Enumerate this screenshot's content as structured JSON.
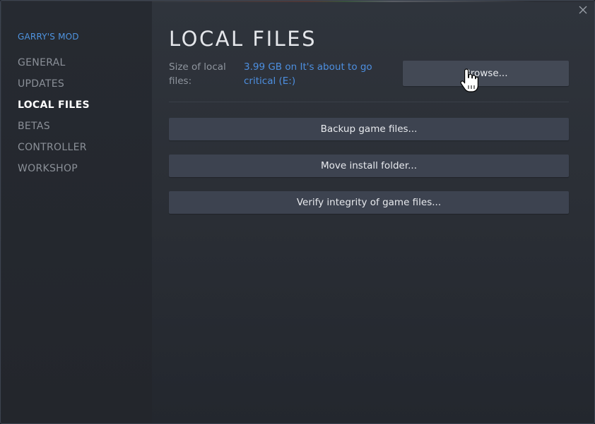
{
  "sidebar": {
    "game_title": "GARRY'S MOD",
    "items": [
      {
        "label": "GENERAL",
        "active": false
      },
      {
        "label": "UPDATES",
        "active": false
      },
      {
        "label": "LOCAL FILES",
        "active": true
      },
      {
        "label": "BETAS",
        "active": false
      },
      {
        "label": "CONTROLLER",
        "active": false
      },
      {
        "label": "WORKSHOP",
        "active": false
      }
    ]
  },
  "main": {
    "title": "LOCAL FILES",
    "size_label": "Size of local files:",
    "size_value": "3.99 GB on It's about to go critical (E:)",
    "browse_button": "Browse...",
    "backup_button": "Backup game files...",
    "move_button": "Move install folder...",
    "verify_button": "Verify integrity of game files..."
  },
  "window": {
    "close_icon": "close-icon"
  },
  "colors": {
    "accent": "#4f94e0",
    "button_bg": "#3d4350",
    "panel_bg": "#2b2f36",
    "sidebar_bg": "#24272d"
  }
}
